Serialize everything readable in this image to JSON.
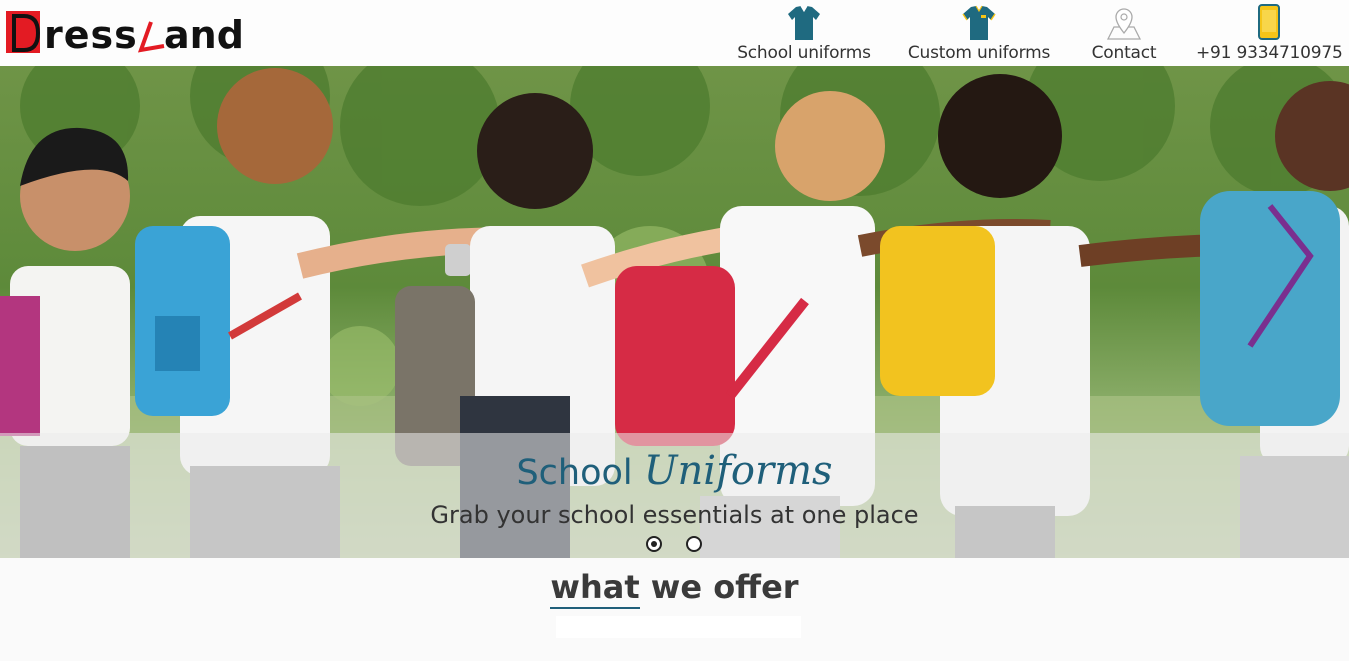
{
  "brand": {
    "logo_text": "DressLand",
    "accent": "#e31b23",
    "logo_color": "#111111"
  },
  "nav": {
    "items": [
      {
        "label": "School uniforms",
        "icon": "school-shirt-icon"
      },
      {
        "label": "Custom uniforms",
        "icon": "custom-shirt-icon"
      },
      {
        "label": "Contact",
        "icon": "location-pin-icon"
      },
      {
        "label": "+91 9334710975",
        "icon": "phone-icon"
      }
    ]
  },
  "hero": {
    "title_plain": "School",
    "title_script": "Uniforms",
    "subtitle": "Grab your school essentials at one place",
    "slides": 2,
    "active_slide": 1,
    "title_color": "#1f5f7a"
  },
  "offer": {
    "title_underlined": "what",
    "title_rest": " we offer"
  }
}
